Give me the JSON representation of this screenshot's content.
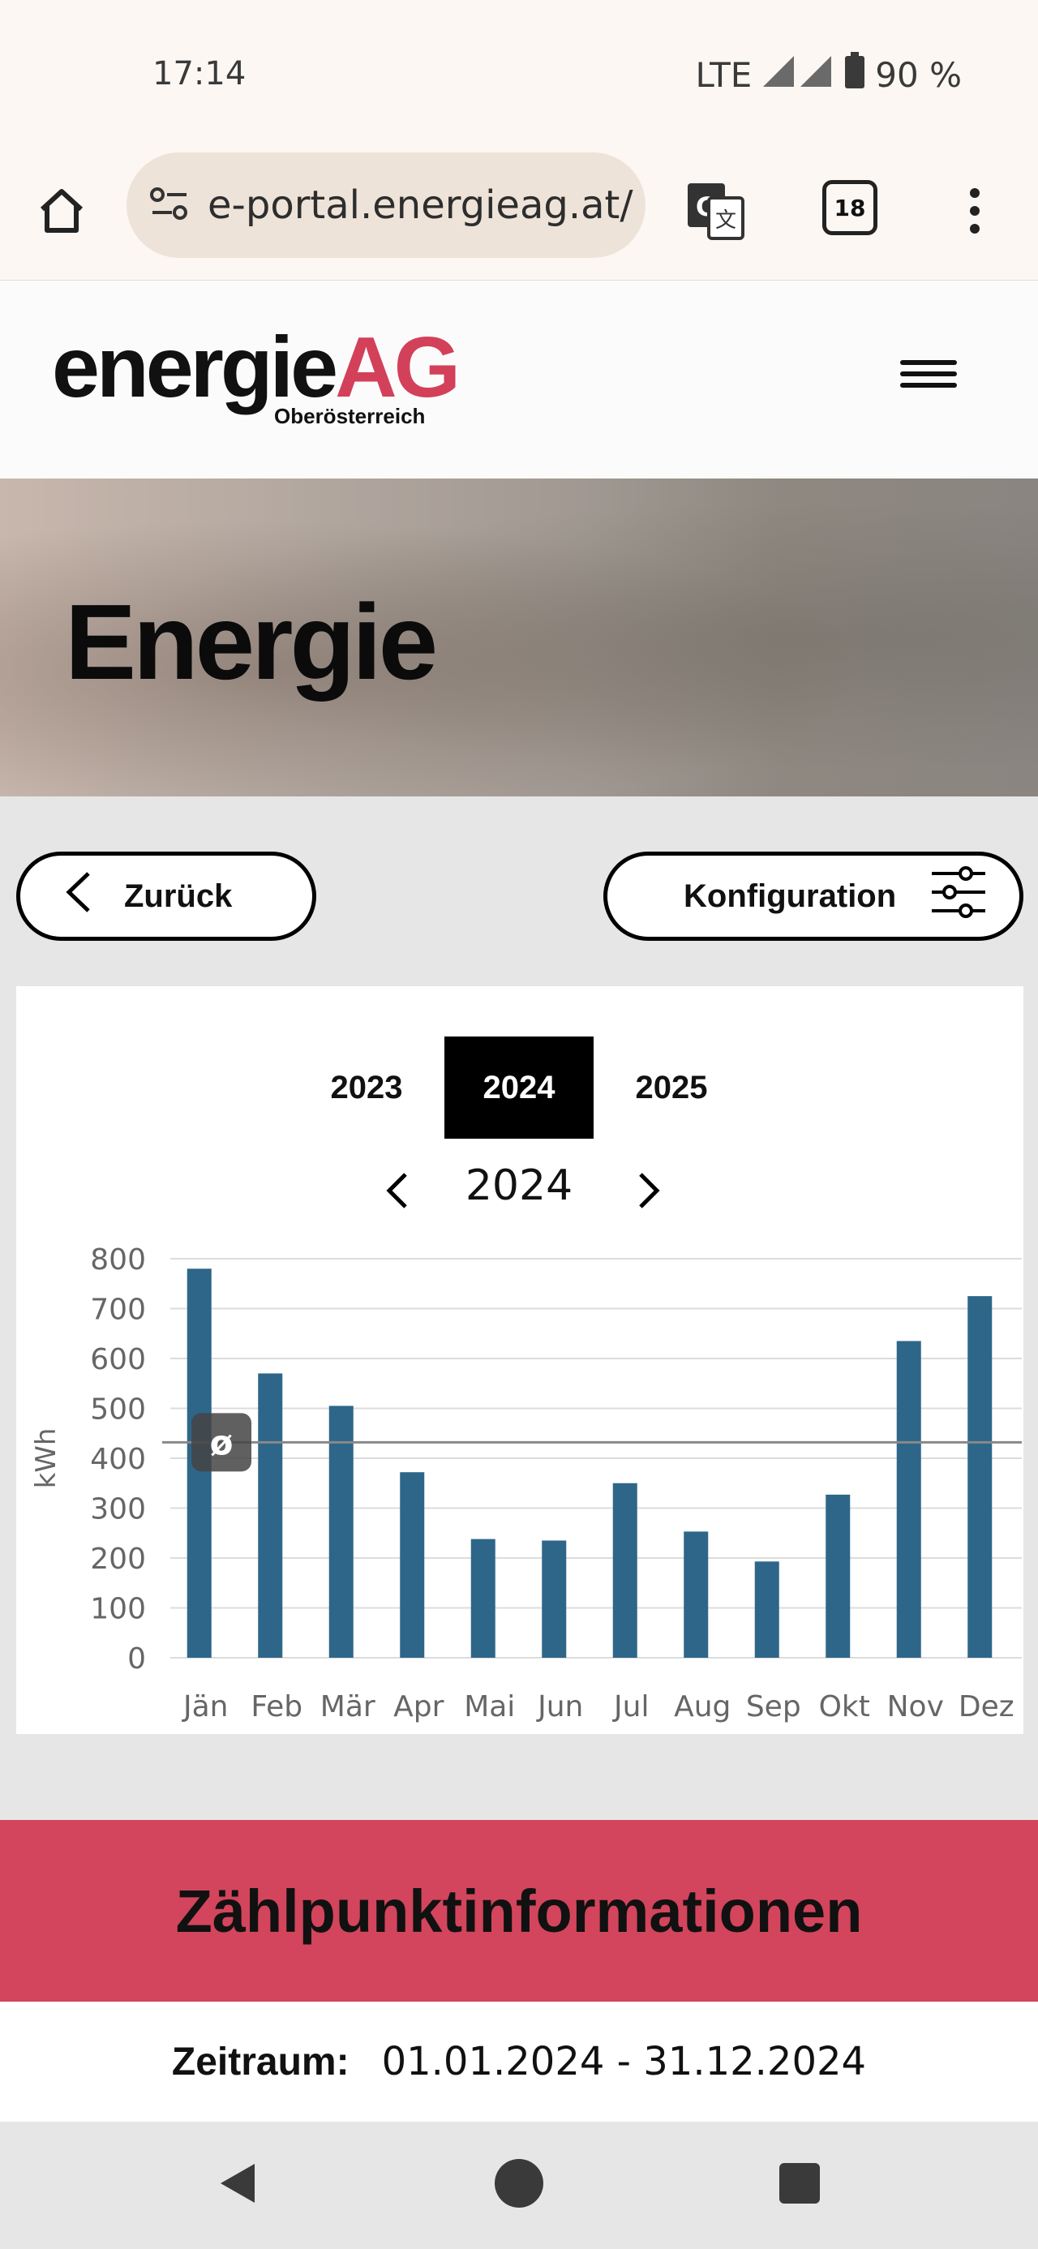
{
  "status_bar": {
    "time": "17:14",
    "network": "LTE",
    "battery": "90 %"
  },
  "browser": {
    "url": "e-portal.energieag.at/",
    "tabs_count": "18"
  },
  "site": {
    "logo_word": "energie",
    "logo_ag": "AG",
    "logo_region": "Oberösterreich",
    "hero_title": "Energie"
  },
  "actions": {
    "back_label": "Zurück",
    "config_label": "Konfiguration"
  },
  "year_tabs": [
    "2023",
    "2024",
    "2025"
  ],
  "selected_year": "2024",
  "year_nav_label": "2024",
  "chart_data": {
    "type": "bar",
    "ylabel": "kWh",
    "categories": [
      "Jän",
      "Feb",
      "Mär",
      "Apr",
      "Mai",
      "Jun",
      "Jul",
      "Aug",
      "Sep",
      "Okt",
      "Nov",
      "Dez"
    ],
    "values": [
      780,
      570,
      505,
      372,
      238,
      235,
      350,
      253,
      193,
      327,
      635,
      725
    ],
    "ylim": [
      0,
      800
    ],
    "yticks": [
      0,
      100,
      200,
      300,
      400,
      500,
      600,
      700,
      800
    ],
    "average": 432,
    "average_symbol": "ø",
    "bar_color": "#2e6689",
    "grid": true
  },
  "section": {
    "title": "Zählpunktinformationen",
    "period_label": "Zeitraum:",
    "period_value": "01.01.2024 - 31.12.2024"
  }
}
